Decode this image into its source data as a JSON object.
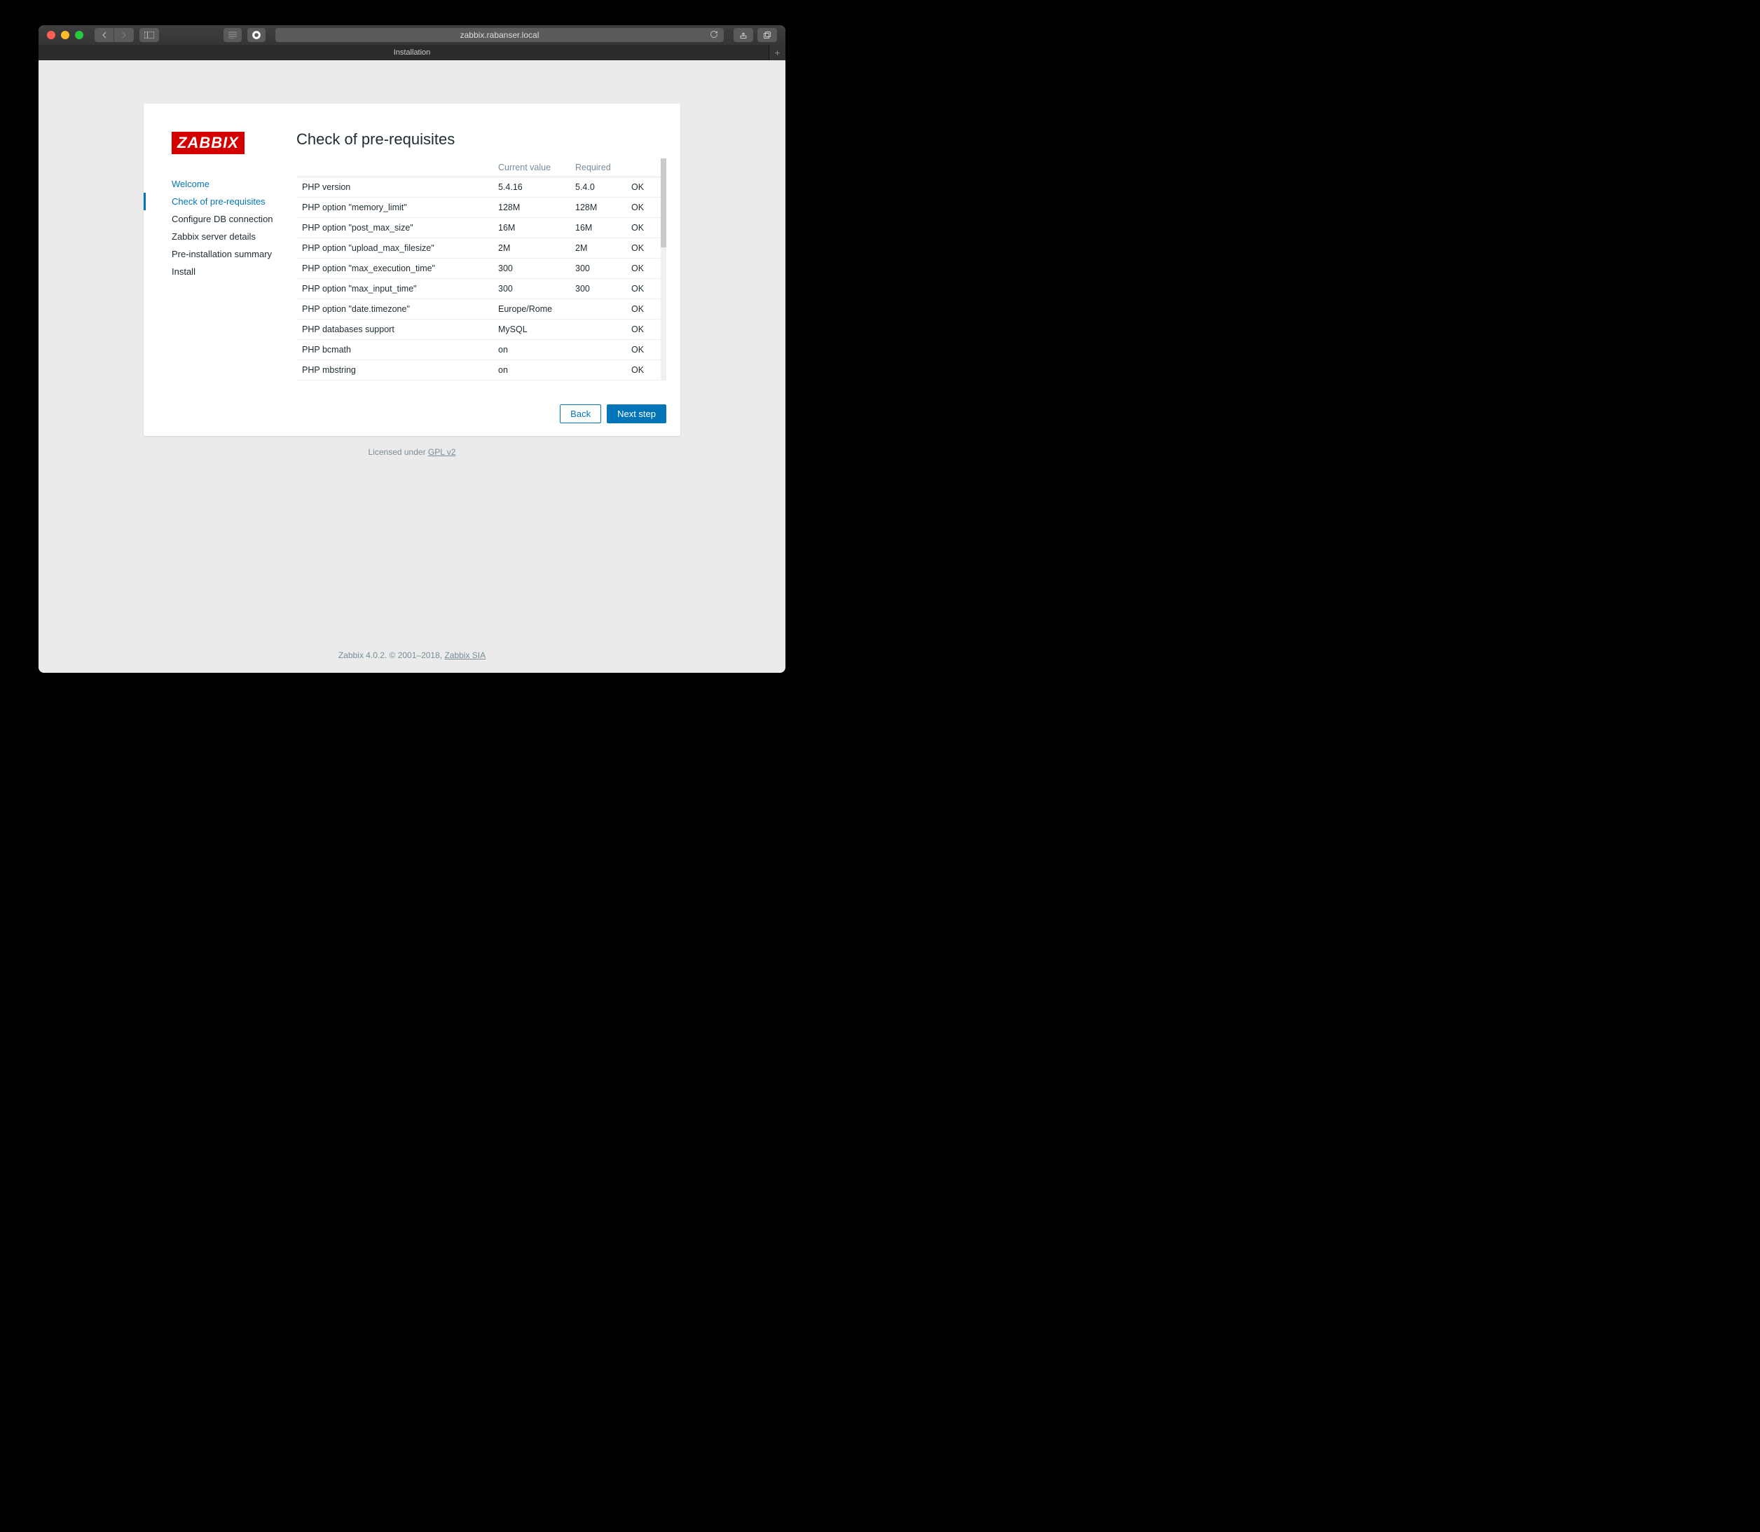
{
  "browser": {
    "url": "zabbix.rabanser.local",
    "tab_title": "Installation"
  },
  "logo_text": "ZABBIX",
  "sidebar": {
    "steps": [
      {
        "label": "Welcome",
        "state": "done"
      },
      {
        "label": "Check of pre-requisites",
        "state": "active"
      },
      {
        "label": "Configure DB connection",
        "state": ""
      },
      {
        "label": "Zabbix server details",
        "state": ""
      },
      {
        "label": "Pre-installation summary",
        "state": ""
      },
      {
        "label": "Install",
        "state": ""
      }
    ]
  },
  "main": {
    "heading": "Check of pre-requisites",
    "columns": {
      "current": "Current value",
      "required": "Required"
    },
    "rows": [
      {
        "name": "PHP version",
        "current": "5.4.16",
        "required": "5.4.0",
        "status": "OK"
      },
      {
        "name": "PHP option \"memory_limit\"",
        "current": "128M",
        "required": "128M",
        "status": "OK"
      },
      {
        "name": "PHP option \"post_max_size\"",
        "current": "16M",
        "required": "16M",
        "status": "OK"
      },
      {
        "name": "PHP option \"upload_max_filesize\"",
        "current": "2M",
        "required": "2M",
        "status": "OK"
      },
      {
        "name": "PHP option \"max_execution_time\"",
        "current": "300",
        "required": "300",
        "status": "OK"
      },
      {
        "name": "PHP option \"max_input_time\"",
        "current": "300",
        "required": "300",
        "status": "OK"
      },
      {
        "name": "PHP option \"date.timezone\"",
        "current": "Europe/Rome",
        "required": "",
        "status": "OK"
      },
      {
        "name": "PHP databases support",
        "current": "MySQL",
        "required": "",
        "status": "OK"
      },
      {
        "name": "PHP bcmath",
        "current": "on",
        "required": "",
        "status": "OK"
      },
      {
        "name": "PHP mbstring",
        "current": "on",
        "required": "",
        "status": "OK"
      }
    ],
    "back_label": "Back",
    "next_label": "Next step"
  },
  "license": {
    "prefix": "Licensed under ",
    "link": "GPL v2"
  },
  "footer": {
    "text": "Zabbix 4.0.2. © 2001–2018, ",
    "link": "Zabbix SIA"
  }
}
